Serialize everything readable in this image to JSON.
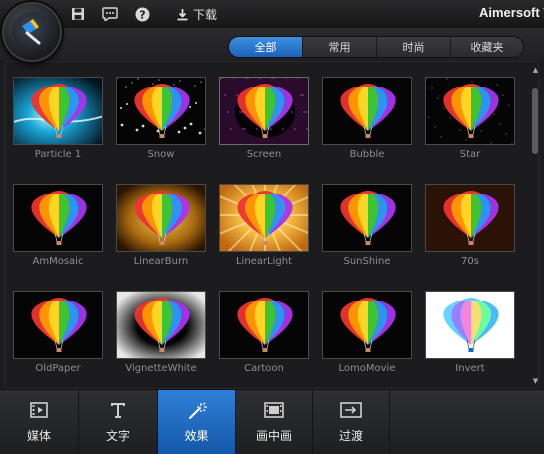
{
  "titlebar": {
    "download_label": "下载",
    "brand": "Aimersoft V",
    "icons": [
      "save-icon",
      "chat-icon",
      "help-icon",
      "download-icon"
    ]
  },
  "filters": {
    "tabs": [
      {
        "label": "全部",
        "active": true
      },
      {
        "label": "常用",
        "active": false
      },
      {
        "label": "时尚",
        "active": false
      },
      {
        "label": "收藏夹",
        "active": false
      }
    ]
  },
  "effects": [
    {
      "label": "Particle 1",
      "style": "particle"
    },
    {
      "label": "Snow",
      "style": "snow"
    },
    {
      "label": "Screen",
      "style": "screen"
    },
    {
      "label": "Bubble",
      "style": "bubble"
    },
    {
      "label": "Star",
      "style": "star"
    },
    {
      "label": "AmMosaic",
      "style": "plain"
    },
    {
      "label": "LinearBurn",
      "style": "burn"
    },
    {
      "label": "LinearLight",
      "style": "light"
    },
    {
      "label": "SunShine",
      "style": "plain"
    },
    {
      "label": "70s",
      "style": "seventies"
    },
    {
      "label": "OldPaper",
      "style": "plain"
    },
    {
      "label": "VignetteWhite",
      "style": "vignette"
    },
    {
      "label": "Cartoon",
      "style": "plain"
    },
    {
      "label": "LomoMovie",
      "style": "plain"
    },
    {
      "label": "Invert",
      "style": "invert"
    }
  ],
  "bottom_nav": [
    {
      "label": "媒体",
      "icon": "film-icon",
      "active": false
    },
    {
      "label": "文字",
      "icon": "text-icon",
      "active": false
    },
    {
      "label": "效果",
      "icon": "magic-wand-icon",
      "active": true
    },
    {
      "label": "画中画",
      "icon": "picture-in-picture-icon",
      "active": false
    },
    {
      "label": "过渡",
      "icon": "transition-icon",
      "active": false
    }
  ]
}
